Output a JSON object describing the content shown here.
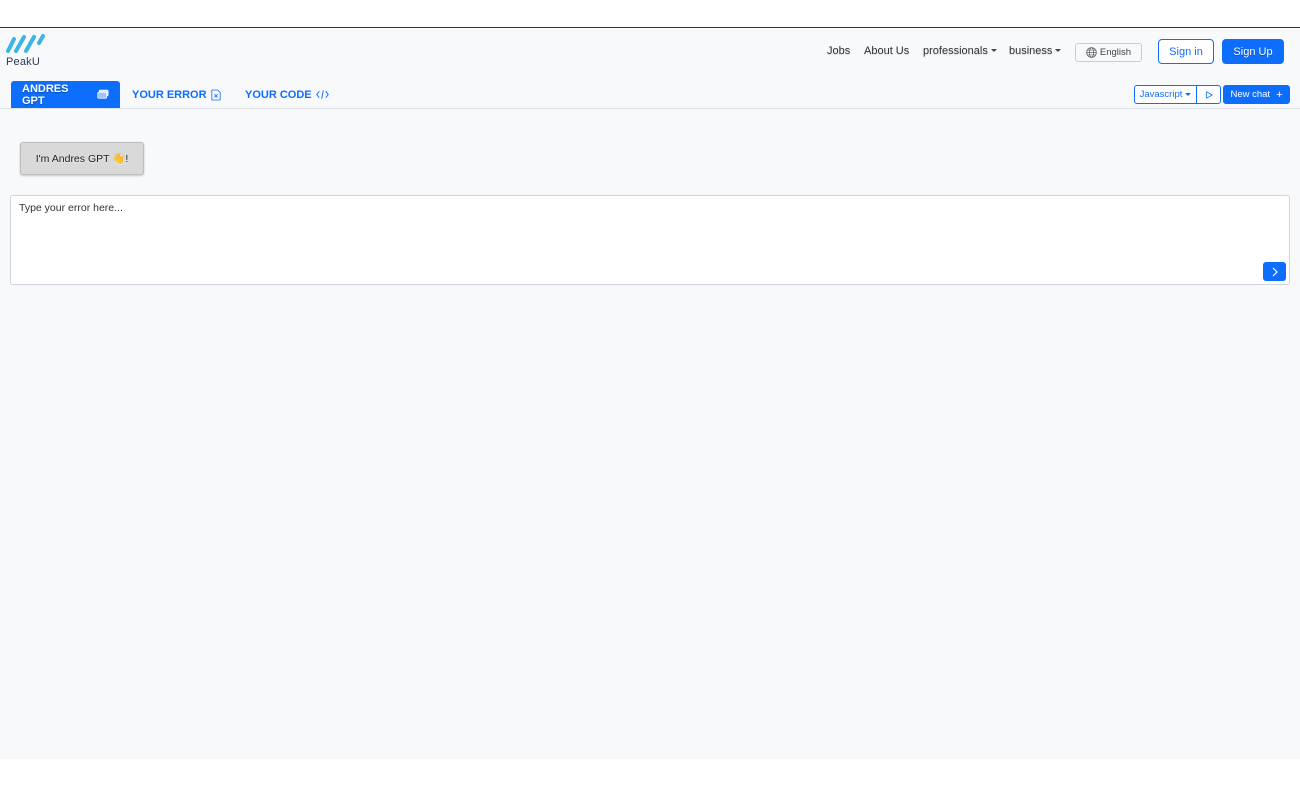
{
  "brand": {
    "name": "PeakU",
    "accent": "#0d6efd",
    "logo_color": "#3bb5e8"
  },
  "nav": {
    "links": [
      "Jobs",
      "About Us"
    ],
    "dropdowns": [
      "professionals",
      "business"
    ],
    "language": "English",
    "signin_label": "Sign in",
    "signup_label": "Sign Up"
  },
  "tabs": [
    {
      "label": "ANDRES GPT",
      "icon": "chat-icon",
      "active": true
    },
    {
      "label": "YOUR ERROR",
      "icon": "file-x-icon",
      "active": false
    },
    {
      "label": "YOUR CODE",
      "icon": "code-icon",
      "active": false
    }
  ],
  "toolbar": {
    "language_select": "Javascript",
    "run_icon": "play-icon",
    "new_chat_label": "New chat",
    "new_chat_icon": "plus-icon"
  },
  "chat": {
    "messages": [
      {
        "text": "I'm Andres GPT 👋!"
      }
    ],
    "input_placeholder": "Type your error here...",
    "send_icon": "chevron-right-icon"
  }
}
